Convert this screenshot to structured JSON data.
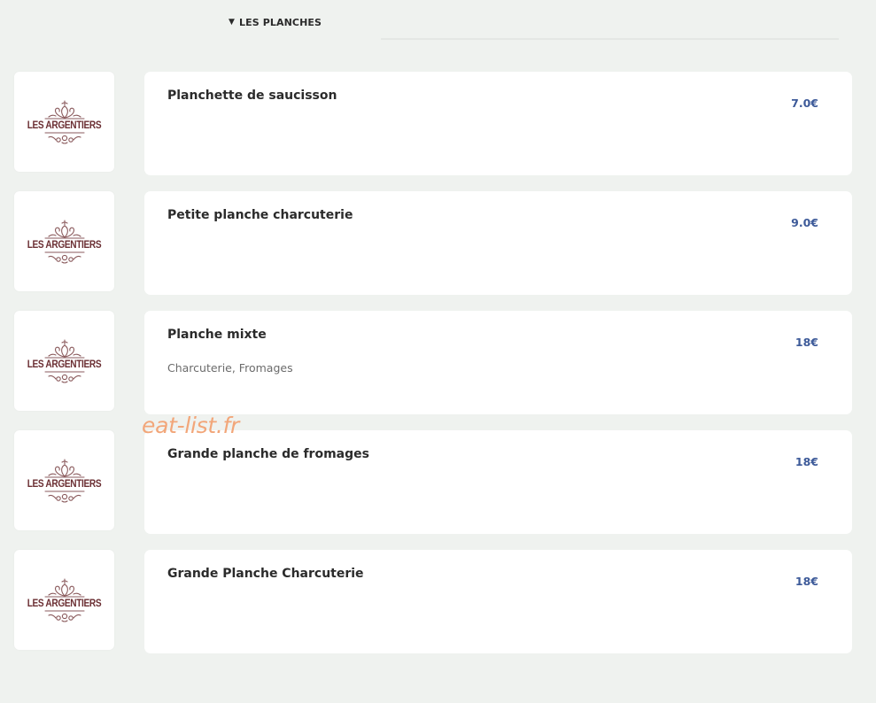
{
  "section": {
    "title": "LES PLANCHES",
    "toggle_icon": "triangle-down-icon"
  },
  "brand": {
    "logo_text": "LES ARGENTIERS",
    "logo_color": "#6b2f33"
  },
  "colors": {
    "price": "#3d5a99",
    "background": "#eff2ef",
    "watermark": "#f2a679"
  },
  "items": [
    {
      "name": "Planchette de saucisson",
      "description": "",
      "price": "7.0€"
    },
    {
      "name": "Petite planche charcuterie",
      "description": "",
      "price": "9.0€"
    },
    {
      "name": "Planche mixte",
      "description": "Charcuterie, Fromages",
      "price": "18€"
    },
    {
      "name": "Grande planche de fromages",
      "description": "",
      "price": "18€"
    },
    {
      "name": "Grande Planche Charcuterie",
      "description": "",
      "price": "18€"
    }
  ],
  "watermark": "eat-list.fr"
}
